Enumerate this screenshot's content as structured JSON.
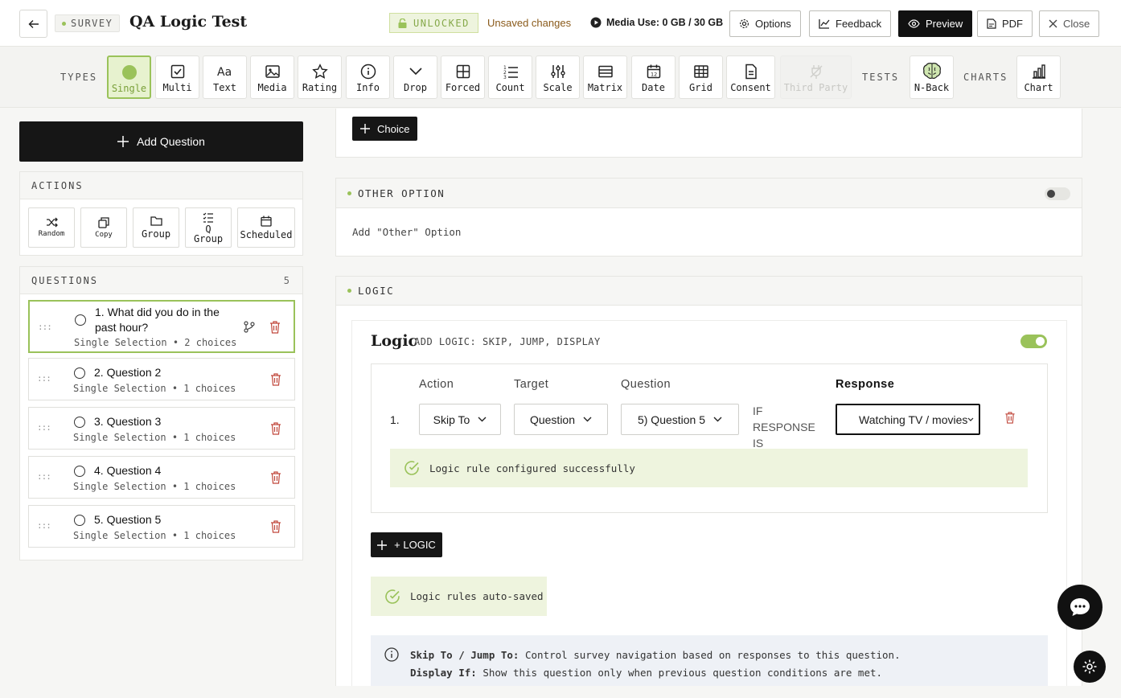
{
  "header": {
    "survey_tag": "SURVEY",
    "title": "QA Logic Test",
    "unlocked": "UNLOCKED",
    "unsaved": "Unsaved changes",
    "media_use": "Media Use: 0 GB / 30 GB",
    "options": "Options",
    "feedback": "Feedback",
    "preview": "Preview",
    "pdf": "PDF",
    "close": "Close"
  },
  "toolbar": {
    "types_label": "TYPES",
    "tests_label": "TESTS",
    "charts_label": "CHARTS",
    "types": [
      "Single",
      "Multi",
      "Text",
      "Media",
      "Rating",
      "Info",
      "Drop",
      "Forced",
      "Count",
      "Scale",
      "Matrix",
      "Date",
      "Grid",
      "Consent",
      "Third Party"
    ],
    "tests": [
      "N-Back"
    ],
    "charts": [
      "Chart"
    ]
  },
  "sidebar": {
    "add_question": "Add Question",
    "actions_label": "ACTIONS",
    "actions": [
      "Random",
      "Copy",
      "Group",
      "Q\nGroup",
      "Scheduled"
    ],
    "questions_label": "QUESTIONS",
    "questions_count": "5",
    "questions": [
      {
        "title": "1. What did you do in the past hour?",
        "sub": "Single Selection • 2 choices"
      },
      {
        "title": "2. Question 2",
        "sub": "Single Selection • 1 choices"
      },
      {
        "title": "3. Question 3",
        "sub": "Single Selection • 1 choices"
      },
      {
        "title": "4. Question 4",
        "sub": "Single Selection • 1 choices"
      },
      {
        "title": "5. Question 5",
        "sub": "Single Selection • 1 choices"
      }
    ]
  },
  "main": {
    "choice_button": "Choice",
    "other_option": {
      "label": "OTHER OPTION",
      "body": "Add \"Other\" Option"
    },
    "logic_section_label": "LOGIC",
    "logic": {
      "title": "Logic",
      "subtitle": "ADD LOGIC: SKIP, JUMP, DISPLAY",
      "columns": {
        "action": "Action",
        "target": "Target",
        "question": "Question",
        "response": "Response"
      },
      "rule": {
        "num": "1.",
        "action": "Skip To",
        "target": "Question",
        "question": "5) Question 5",
        "condition": "IF RESPONSE IS",
        "response": "Watching TV / movies"
      },
      "rule_success": "Logic rule configured successfully",
      "add_logic": "+ LOGIC",
      "autosaved": "Logic rules auto-saved",
      "info_1_label": "Skip To / Jump To:",
      "info_1_text": "Control survey navigation based on responses to this question.",
      "info_2_label": "Display If:",
      "info_2_text": "Show this question only when previous question conditions are met."
    }
  },
  "colors": {
    "accent": "#9ac25a",
    "dark": "#111111",
    "success_bg": "#eef4de"
  }
}
